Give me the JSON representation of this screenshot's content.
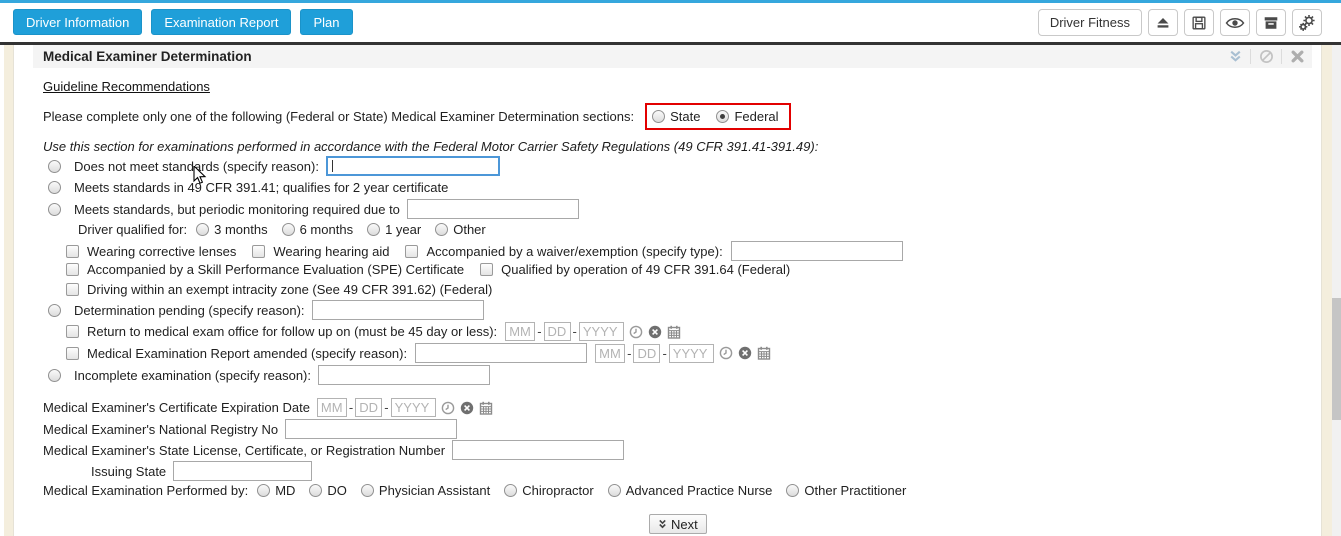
{
  "colors": {
    "accent_blue": "#1f9fd9",
    "highlight_red": "#e20000",
    "page_beige": "#f4eedd"
  },
  "toolbar": {
    "tabs": [
      {
        "label": "Driver Information"
      },
      {
        "label": "Examination Report"
      },
      {
        "label": "Plan"
      }
    ],
    "driver_fitness": "Driver Fitness",
    "icon_names": [
      "eject-icon",
      "save-icon",
      "eye-icon",
      "archive-icon",
      "gears-icon"
    ]
  },
  "panel": {
    "title": "Medical Examiner Determination",
    "header_icon_names": [
      "collapse-chevron-icon",
      "ban-icon",
      "close-icon"
    ],
    "link": "Guideline Recommendations",
    "intro": "Please complete only one of the following (Federal or State) Medical Examiner Determination sections:",
    "scope": {
      "state": "State",
      "federal": "Federal",
      "selected": "Federal"
    },
    "federal_note": "Use this section for examinations performed in accordance with the Federal Motor Carrier Safety Regulations (49 CFR 391.41-391.49):"
  },
  "options": {
    "does_not_meet": "Does not meet standards (specify reason):",
    "meets_2yr": "Meets standards in 49 CFR 391.41; qualifies for 2 year certificate",
    "meets_monitoring": "Meets standards, but periodic monitoring required due to",
    "qualified_for": "Driver qualified for:",
    "durations": [
      "3 months",
      "6 months",
      "1 year",
      "Other"
    ],
    "cb_lenses": "Wearing corrective lenses",
    "cb_hearing": "Wearing hearing aid",
    "cb_waiver": "Accompanied by a waiver/exemption (specify type):",
    "cb_spe": "Accompanied by a Skill Performance Evaluation (SPE) Certificate",
    "cb_39164": "Qualified by operation of 49 CFR 391.64 (Federal)",
    "cb_intracity": "Driving within an exempt intracity zone (See 49 CFR 391.62) (Federal)",
    "pending": "Determination pending (specify reason):",
    "return_followup": "Return to medical exam office for follow up on (must be 45 day or less):",
    "amended": "Medical Examination Report amended (specify reason):",
    "incomplete": "Incomplete examination (specify reason):"
  },
  "fields": {
    "cert_expiration": "Medical Examiner's Certificate Expiration Date",
    "registry_no": "Medical Examiner's National Registry No",
    "state_license": "Medical Examiner's State License, Certificate, or Registration Number",
    "issuing_state": "Issuing State",
    "performed_by": "Medical Examination Performed by:",
    "practitioners": [
      "MD",
      "DO",
      "Physician Assistant",
      "Chiropractor",
      "Advanced Practice Nurse",
      "Other Practitioner"
    ]
  },
  "date": {
    "mm": "MM",
    "dd": "DD",
    "yyyy": "YYYY",
    "sep": "-"
  },
  "footer": {
    "next": "Next"
  }
}
